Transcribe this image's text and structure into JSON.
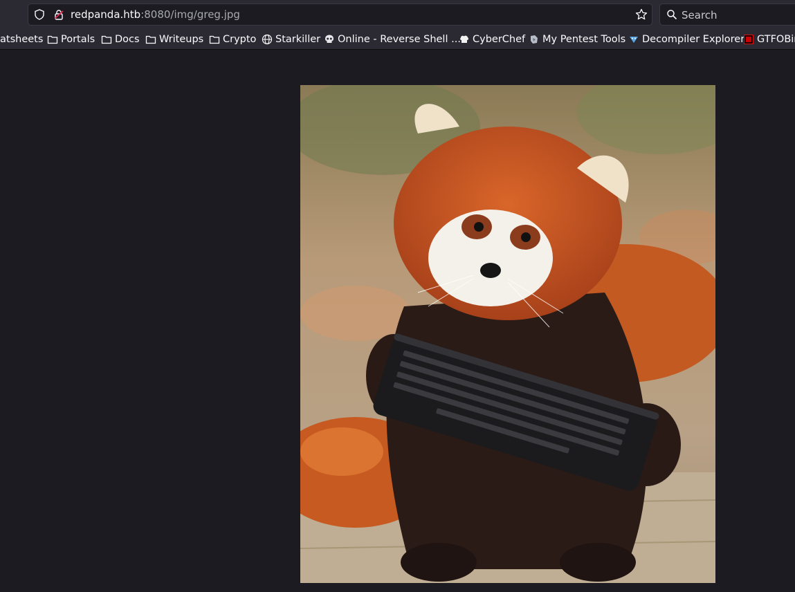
{
  "browser": {
    "url_host": "redpanda.htb",
    "url_rest": ":8080/img/greg.jpg",
    "search_placeholder": "Search"
  },
  "bookmarks": [
    {
      "label": "atsheets",
      "icon": "none"
    },
    {
      "label": "Portals",
      "icon": "folder-icon"
    },
    {
      "label": "Docs",
      "icon": "folder-icon"
    },
    {
      "label": "Writeups",
      "icon": "folder-icon"
    },
    {
      "label": "Crypto",
      "icon": "folder-icon"
    },
    {
      "label": "Starkiller",
      "icon": "globe-icon"
    },
    {
      "label": "Online - Reverse Shell ...",
      "icon": "skull-icon"
    },
    {
      "label": "CyberChef",
      "icon": "chef-icon"
    },
    {
      "label": "My Pentest Tools",
      "icon": "pentest-icon"
    },
    {
      "label": "Decompiler Explorer",
      "icon": "dogbolt-icon"
    },
    {
      "label": "GTFOBin",
      "icon": "gtfobins-icon"
    }
  ],
  "image": {
    "subject": "red-panda-with-keyboard",
    "colors": {
      "fur_orange": "#c2521e",
      "fur_dark": "#2a1a16",
      "background": "#9a8a6e"
    }
  }
}
